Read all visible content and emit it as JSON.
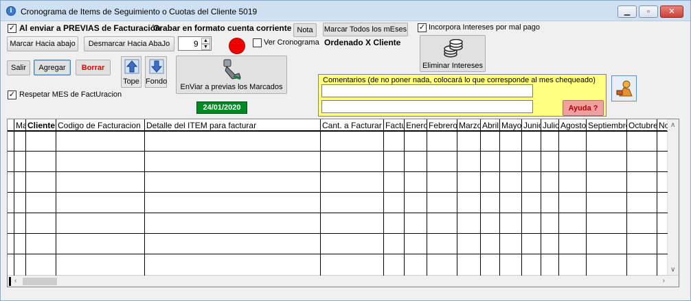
{
  "window": {
    "title": "Cronograma de Items de Seguimiento o Cuotas del Cliente 5019",
    "controls": {
      "minimize": "▁",
      "maximize": "▫",
      "close": "✕"
    }
  },
  "options": {
    "al_enviar_label": "Al enviar a PREVIAS de Facturación",
    "al_enviar_checked": true,
    "grabar_label": "Grabar en formato cuenta corriente",
    "nota_label": "Nota",
    "marcar_todos_label": "Marcar Todos los mEses",
    "incorpora_label": "Incorpora Intereses por mal pago",
    "incorpora_checked": true,
    "ver_cronograma_label": "Ver Cronograma",
    "ver_cronograma_checked": false,
    "ordenado_label": "Ordenado X Cliente",
    "respetar_label": "Respetar MES de FactUracion",
    "respetar_checked": true
  },
  "toolbar": {
    "marcar_hacia_abajo": "Marcar Hacia abajo",
    "desmarcar_hacia_abajo": "Desmarcar Hacia AbaJo",
    "spinner_value": "9",
    "salir": "Salir",
    "agregar": "Agregar",
    "borrar": "Borrar",
    "tope": "Tope",
    "fondo": "Fondo",
    "enviar_label": "EnViar a previas los Marcados",
    "eliminar_intereses": "Eliminar Intereses",
    "date": "24/01/2020"
  },
  "comments": {
    "label": "Comentarios (de no poner nada, colocará lo que corresponde al mes chequeado)",
    "field1": "",
    "field2": "",
    "ayuda": "Ayuda ?"
  },
  "grid": {
    "columns": [
      "Mar",
      "Cliente",
      "Codigo de Facturacion",
      "Detalle del ITEM para facturar",
      "Cant. a Facturar",
      "Factu",
      "Enero",
      "Febrero",
      "Marzo",
      "Abril",
      "Mayo",
      "Junio",
      "Julio",
      "Agosto",
      "Septiembre",
      "Octubre",
      "Nov"
    ],
    "rows": 7
  },
  "colors": {
    "status_dot": "#ee0000",
    "date_bg": "#008a25",
    "comments_bg": "#ffff80",
    "ayuda_bg": "#f0a0a0"
  }
}
